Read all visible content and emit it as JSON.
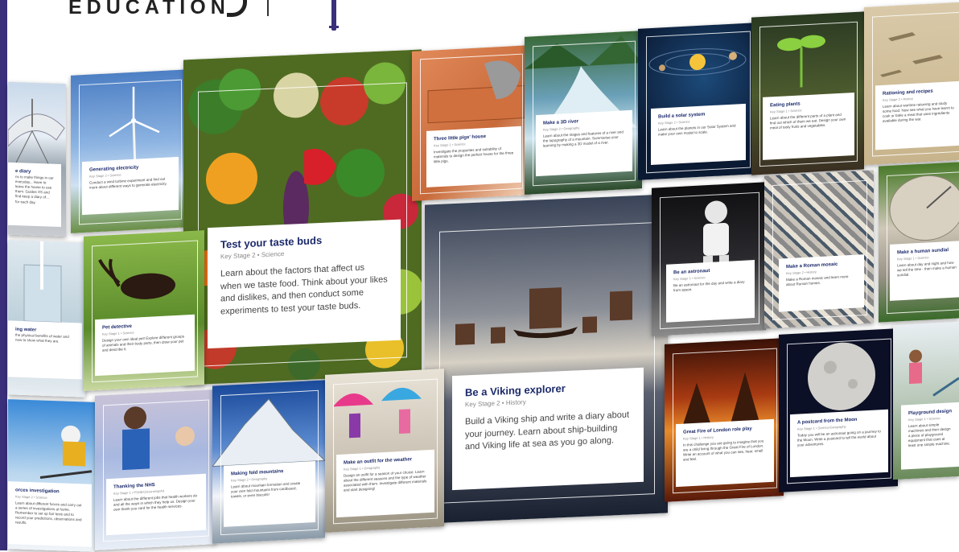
{
  "logo": {
    "wordmark": "EDUCATION",
    "tm": "™"
  },
  "cards": {
    "radio_diary": {
      "title": "e diary",
      "desc": "ns to make things in our everyday... Have to leave the house to use them. Guides XS and find keep a diary of... for each day."
    },
    "electricity": {
      "title": "Generating electricity",
      "sub": "Key Stage 2 • Science",
      "desc": "Conduct a wind turbine experiment and find out more about different ways to generate electricity."
    },
    "taste": {
      "title": "Test your taste buds",
      "sub": "Key Stage 2 • Science",
      "desc": "Learn about the factors that affect us when we taste food. Think about your likes and dislikes, and then conduct some experiments to test your taste buds."
    },
    "pigs": {
      "title": "Three little pigs' house",
      "sub": "Key Stage 1 • Science",
      "desc": "Investigate the properties and suitability of materials to design the perfect house for the three little pigs."
    },
    "river": {
      "title": "Make a 3D river",
      "sub": "Key Stage 2 • Geography",
      "desc": "Learn about the stages and features of a river and the topography of a mountain. Summarise your learning by making a 3D model of a river."
    },
    "solar": {
      "title": "Build a solar system",
      "sub": "Key Stage 2 • Science",
      "desc": "Learn about the planets in our Solar System and make your own model to scale."
    },
    "plants": {
      "title": "Eating plants",
      "sub": "Key Stage 1 • Science",
      "desc": "Learn about the different parts of a plant and find out which of them we eat. Design your own meal of tasty fruits and vegetables."
    },
    "rationing": {
      "title": "Rationing and recipes",
      "sub": "Key Stage 2 • History",
      "desc": "Learn about wartime rationing and study some food. Now see what you have learnt to cook or bake a meal that uses ingredients available during the war."
    },
    "water": {
      "title": "ing water",
      "desc": "the physical benefits of water and now to show what they are."
    },
    "pet": {
      "title": "Pet detective",
      "sub": "Key Stage 1 • Science",
      "desc": "Design your own ideal pet! Explore different groups of animals and their body parts, then draw your pet and describe it."
    },
    "viking": {
      "title": "Be a Viking explorer",
      "sub": "Key Stage 2 • History",
      "desc": "Build a Viking ship and write a diary about your journey. Learn about ship-building and Viking life at sea as you go along."
    },
    "astronaut": {
      "title": "Be an astronaut",
      "sub": "Key Stage 1 • Science",
      "desc": "Be an astronaut for the day and write a diary from space."
    },
    "mosaic": {
      "title": "Make a Roman mosaic",
      "sub": "Key Stage 2 • History",
      "desc": "Make a Roman mosaic and learn more about Roman homes."
    },
    "sundial": {
      "title": "Make a human sundial",
      "sub": "Key Stage 1 • Science",
      "desc": "Learn about day and night and how we tell the time - then make a human sundial."
    },
    "forces": {
      "title": "orces investigation",
      "sub": "Key Stage 2 • Science",
      "desc": "Learn about different forces and carry out a series of investigations at home. Remember to set up fair tests and to record your predictions, observations and results."
    },
    "nhs": {
      "title": "Thanking the NHS",
      "sub": "Key Stage 1 • PSHE/Citizenship/Art",
      "desc": "Learn about the different jobs that health workers do and all the ways in which they help us. Design your own thank-you card for the health services."
    },
    "mountains": {
      "title": "Making fold mountains",
      "sub": "Key Stage 2 • Geography",
      "desc": "Learn about mountain formation and create your own fold mountains from cardboard, towels, or even biscuits!"
    },
    "weather": {
      "title": "Make an outfit for the weather",
      "sub": "Key Stage 1 • Geography",
      "desc": "Design an outfit for a season of your choice. Learn about the different seasons and the type of weather associated with them. Investigate different materials and start designing!"
    },
    "fire": {
      "title": "Great Fire of London role play",
      "sub": "Key Stage 1 • History",
      "desc": "In this challenge you are going to imagine that you are a child living through the Great Fire of London. Write an account of what you can see, hear, smell and feel."
    },
    "moon": {
      "title": "A postcard from the Moon",
      "sub": "Key Stage 1 • Science/Geography",
      "desc": "Today you will be an astronaut going on a journey to the Moon. Write a postcard to tell the world about your adventures."
    },
    "playground": {
      "title": "Playground design",
      "sub": "Key Stage 1 • Science",
      "desc": "Learn about simple machines and then design a piece of playground equipment that uses at least one simple machine."
    }
  }
}
